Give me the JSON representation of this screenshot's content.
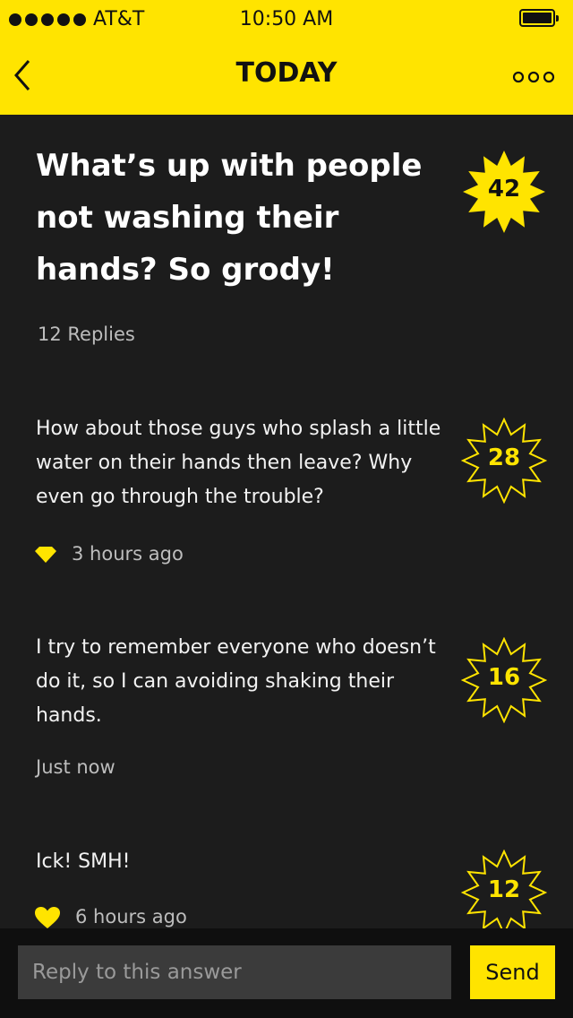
{
  "status_bar": {
    "carrier": "AT&T",
    "time": "10:50 AM"
  },
  "nav": {
    "title": "TODAY",
    "back_icon": "chevron-left-icon",
    "more_icon": "more-dots-icon"
  },
  "question": {
    "title": "What’s up with people not washing their hands? So grody!",
    "score": "42",
    "replies": "12 Replies"
  },
  "answers": [
    {
      "text": "How about those guys who splash a little water on their hands then leave? Why even go through the trouble?",
      "score": "28",
      "time": "3 hours ago",
      "icon": "diamond-icon"
    },
    {
      "text": "I try to remember everyone who doesn’t do it, so I can avoiding shaking their hands.",
      "score": "16",
      "time": "Just now",
      "icon": ""
    },
    {
      "text": "Ick! SMH!",
      "score": "12",
      "time": "6 hours ago",
      "icon": "heart-icon"
    }
  ],
  "reply_bar": {
    "placeholder": "Reply to this answer",
    "send_label": "Send"
  },
  "colors": {
    "accent": "#ffe400",
    "background": "#1c1c1c",
    "text": "#ffffff",
    "muted": "#bdbdbd"
  }
}
